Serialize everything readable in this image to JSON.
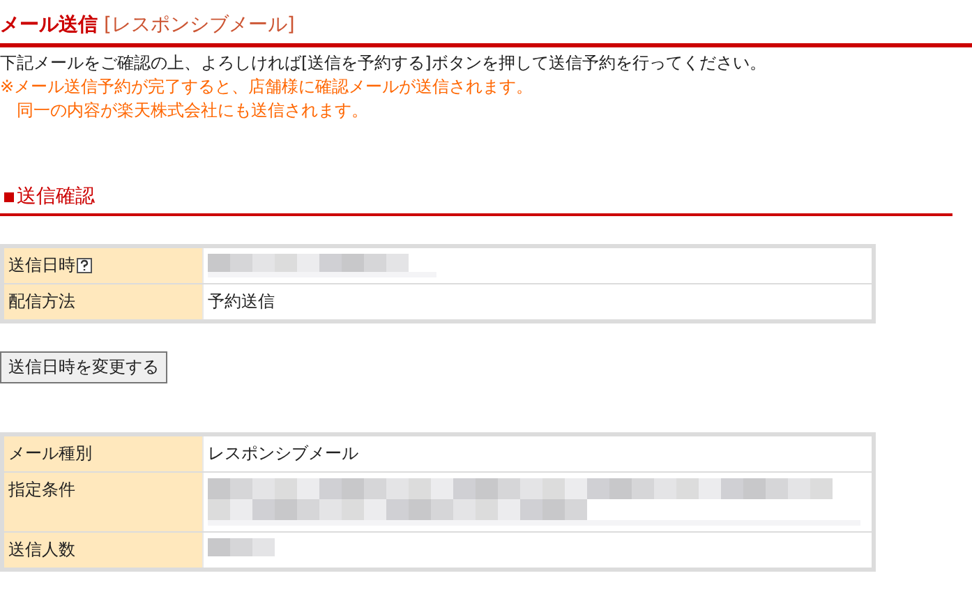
{
  "page_title": {
    "main": "メール送信",
    "sub": "[レスポンシブメール]"
  },
  "instructions": [
    "下記メールをご確認の上、よろしければ[送信を予約する]ボタンを押して送信予約を行ってください。"
  ],
  "notes": [
    "※メール送信予約が完了すると、店舗様に確認メールが送信されます。",
    "　同一の内容が楽天株式会社にも送信されます。"
  ],
  "section": {
    "title": "送信確認"
  },
  "table_1": [
    {
      "label": "送信日時",
      "help": true,
      "kind": "redacted_line"
    },
    {
      "label": "配信方法",
      "kind": "text",
      "value": "予約送信"
    }
  ],
  "change_button": "送信日時を変更する",
  "table_2": [
    {
      "label": "メール種別",
      "kind": "text",
      "value": "レスポンシブメール"
    },
    {
      "label": "指定条件",
      "kind": "redacted_block"
    },
    {
      "label": "送信人数",
      "kind": "redacted_short"
    }
  ]
}
